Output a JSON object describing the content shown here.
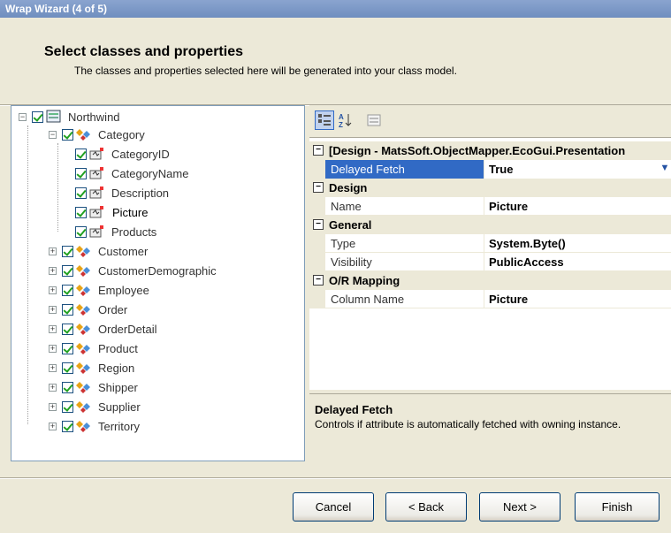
{
  "window": {
    "title": "Wrap Wizard (4 of 5)"
  },
  "header": {
    "title": "Select classes and properties",
    "subtitle": "The classes and properties selected here will be generated into your class model."
  },
  "tree": {
    "root": "Northwind",
    "category": "Category",
    "properties": [
      "CategoryID",
      "CategoryName",
      "Description",
      "Picture",
      "Products"
    ],
    "classes": [
      "Customer",
      "CustomerDemographic",
      "Employee",
      "Order",
      "OrderDetail",
      "Product",
      "Region",
      "Shipper",
      "Supplier",
      "Territory"
    ],
    "selected": "Picture"
  },
  "props": {
    "toolbar": {
      "categorized_icon": "categorized-icon",
      "alpha_icon": "alphabetical-sort-icon",
      "pages_icon": "property-pages-icon"
    },
    "categories": [
      {
        "name": "[Design - MatsSoft.ObjectMapper.EcoGui.Presentation",
        "rows": [
          {
            "key": "Delayed Fetch",
            "value": "True",
            "selected": true
          }
        ]
      },
      {
        "name": "Design",
        "rows": [
          {
            "key": "Name",
            "value": "Picture"
          }
        ]
      },
      {
        "name": "General",
        "rows": [
          {
            "key": "Type",
            "value": "System.Byte()"
          },
          {
            "key": "Visibility",
            "value": "PublicAccess"
          }
        ]
      },
      {
        "name": "O/R Mapping",
        "rows": [
          {
            "key": "Column Name",
            "value": "Picture"
          }
        ]
      }
    ],
    "description": {
      "title": "Delayed Fetch",
      "text": "Controls if attribute is automatically fetched with owning instance."
    }
  },
  "buttons": {
    "cancel": "Cancel",
    "back": "< Back",
    "next": "Next >",
    "finish": "Finish"
  },
  "colors": {
    "selection": "#316ac5",
    "window_bg": "#ECE9D8",
    "check": "#21a121"
  }
}
